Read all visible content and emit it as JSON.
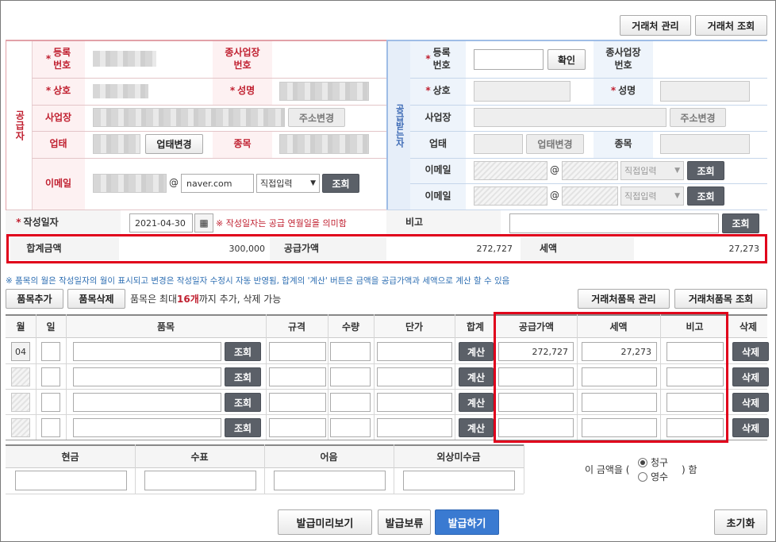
{
  "top_buttons": {
    "partner_manage": "거래처 관리",
    "partner_search": "거래처 조회"
  },
  "supplier": {
    "side_label": "공급자",
    "reg_no_label": "등록\n번호",
    "sub_no_label": "종사업장\n번호",
    "name_label": "상호",
    "ceo_label": "성명",
    "address_label": "사업장",
    "address_change": "주소변경",
    "biz_type_label": "업태",
    "biz_type_change": "업태변경",
    "item_label": "종목",
    "email_label": "이메일",
    "email_at": "@",
    "email_domain": "naver.com",
    "email_select": "직접입력",
    "search": "조회"
  },
  "receiver": {
    "side_label": "공급받는자",
    "reg_no_label": "등록\n번호",
    "confirm": "확인",
    "sub_no_label": "종사업장\n번호",
    "name_label": "상호",
    "ceo_label": "성명",
    "address_label": "사업장",
    "address_change": "주소변경",
    "biz_type_label": "업태",
    "biz_type_change": "업태변경",
    "item_label": "종목",
    "email_label": "이메일",
    "email_at": "@",
    "email_select": "직접입력",
    "search": "조회"
  },
  "write_date": {
    "label": "작성일자",
    "value": "2021-04-30",
    "note": "※ 작성일자는 공급 연월일을 의미함",
    "remark_label": "비고",
    "search": "조회"
  },
  "totals": {
    "total_label": "합계금액",
    "total_value": "300,000",
    "supply_label": "공급가액",
    "supply_value": "272,727",
    "tax_label": "세액",
    "tax_value": "27,273"
  },
  "notice": "※ 품목의 월은 작성일자의 월이 표시되고 변경은 작성일자 수정시 자동 반영됨, 합계의 '계산' 버튼은 금액을 공급가액과 세액으로 계산 할 수 있음",
  "item_controls": {
    "add": "품목추가",
    "delete": "품목삭제",
    "info_pre": "품목은 최대 ",
    "info_count": "16개",
    "info_post": "까지 추가, 삭제 가능",
    "manage": "거래처품목 관리",
    "search": "거래처품목 조회"
  },
  "table_headers": {
    "month": "월",
    "day": "일",
    "item": "품목",
    "spec": "규격",
    "qty": "수량",
    "price": "단가",
    "sum": "합계",
    "supply": "공급가액",
    "tax": "세액",
    "remark": "비고",
    "delete": "삭제"
  },
  "rows": [
    {
      "month": "04",
      "search": "조회",
      "calc": "계산",
      "supply": "272,727",
      "tax": "27,273",
      "delete": "삭제"
    },
    {
      "month": "",
      "search": "조회",
      "calc": "계산",
      "supply": "",
      "tax": "",
      "delete": "삭제"
    },
    {
      "month": "",
      "search": "조회",
      "calc": "계산",
      "supply": "",
      "tax": "",
      "delete": "삭제"
    },
    {
      "month": "",
      "search": "조회",
      "calc": "계산",
      "supply": "",
      "tax": "",
      "delete": "삭제"
    }
  ],
  "payment": {
    "cash": "현금",
    "check": "수표",
    "note": "어음",
    "credit": "외상미수금",
    "amount_pre": "이 금액을 (",
    "opt_claim": "청구",
    "opt_receipt": "영수",
    "amount_post": ") 함"
  },
  "bottom_buttons": {
    "preview": "발급미리보기",
    "hold": "발급보류",
    "issue": "발급하기",
    "reset": "초기화"
  }
}
